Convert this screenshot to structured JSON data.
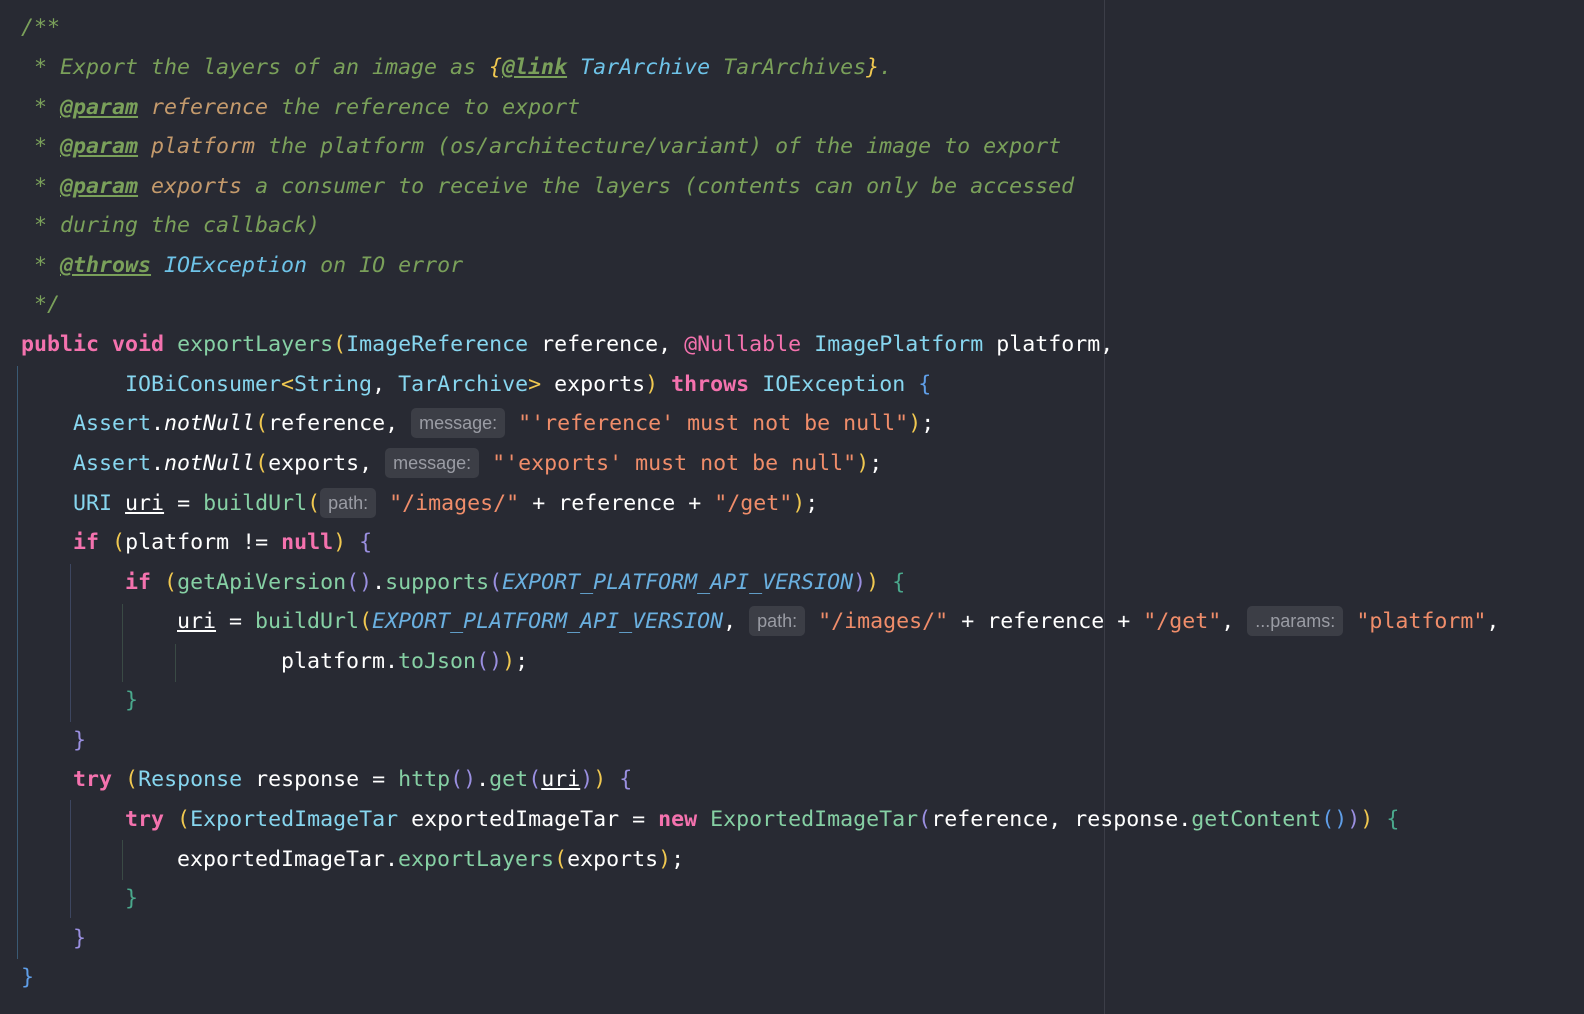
{
  "doc": {
    "open": "/**",
    "export_pre": " * Export the layers of an image as ",
    "link_open": "{",
    "link_tag": "@link",
    "link_type": "TarArchive",
    "link_text": " TarArchives",
    "link_close": "}",
    "link_period": ".",
    "star": " * ",
    "param_tag": "@param",
    "p1_name": "reference",
    "p1_desc": " the reference to export",
    "p2_name": "platform",
    "p2_desc": " the platform (os/architecture/variant) of the image to export",
    "p3_name": "exports",
    "p3_desc": " a consumer to receive the layers (contents can only be accessed",
    "p3_cont": " * during the callback)",
    "throws_tag": "@throws",
    "throws_type": "IOException",
    "throws_desc": " on IO error",
    "close": " */"
  },
  "code": {
    "kw_public": "public",
    "kw_void": "void",
    "kw_throws": "throws",
    "kw_if": "if",
    "kw_null": "null",
    "kw_try": "try",
    "kw_new": "new",
    "m_exportLayers": "exportLayers",
    "t_ImageReference": "ImageReference",
    "v_reference": "reference",
    "a_nullable": "@Nullable",
    "t_ImagePlatform": "ImagePlatform",
    "v_platform": "platform",
    "t_IOBiConsumer": "IOBiConsumer",
    "t_String": "String",
    "t_TarArchive": "TarArchive",
    "v_exports": "exports",
    "t_IOException": "IOException",
    "c_Assert": "Assert",
    "m_notNull": "notNull",
    "s_ref_null": "\"'reference' must not be null\"",
    "s_exp_null": "\"'exports' must not be null\"",
    "t_URI": "URI",
    "v_uri": "uri",
    "m_buildUrl": "buildUrl",
    "s_images": "\"/images/\"",
    "s_get": "\"/get\"",
    "m_getApiVersion": "getApiVersion",
    "m_supports": "supports",
    "c_export_platform": "EXPORT_PLATFORM_API_VERSION",
    "s_platform": "\"platform\"",
    "m_toJson": "toJson",
    "t_Response": "Response",
    "v_response": "response",
    "m_http": "http",
    "m_get": "get",
    "t_ExportedImageTar": "ExportedImageTar",
    "v_exportedImageTar": "exportedImageTar",
    "m_getContent": "getContent"
  },
  "hints": {
    "message": "message:",
    "path": "path:",
    "params": "...params:"
  },
  "colors": {
    "background": "#282a33",
    "keyword": "#f472ae",
    "method": "#86d0a4",
    "type": "#87d6ef",
    "string": "#f08d6a",
    "comment": "#7aa05a"
  }
}
